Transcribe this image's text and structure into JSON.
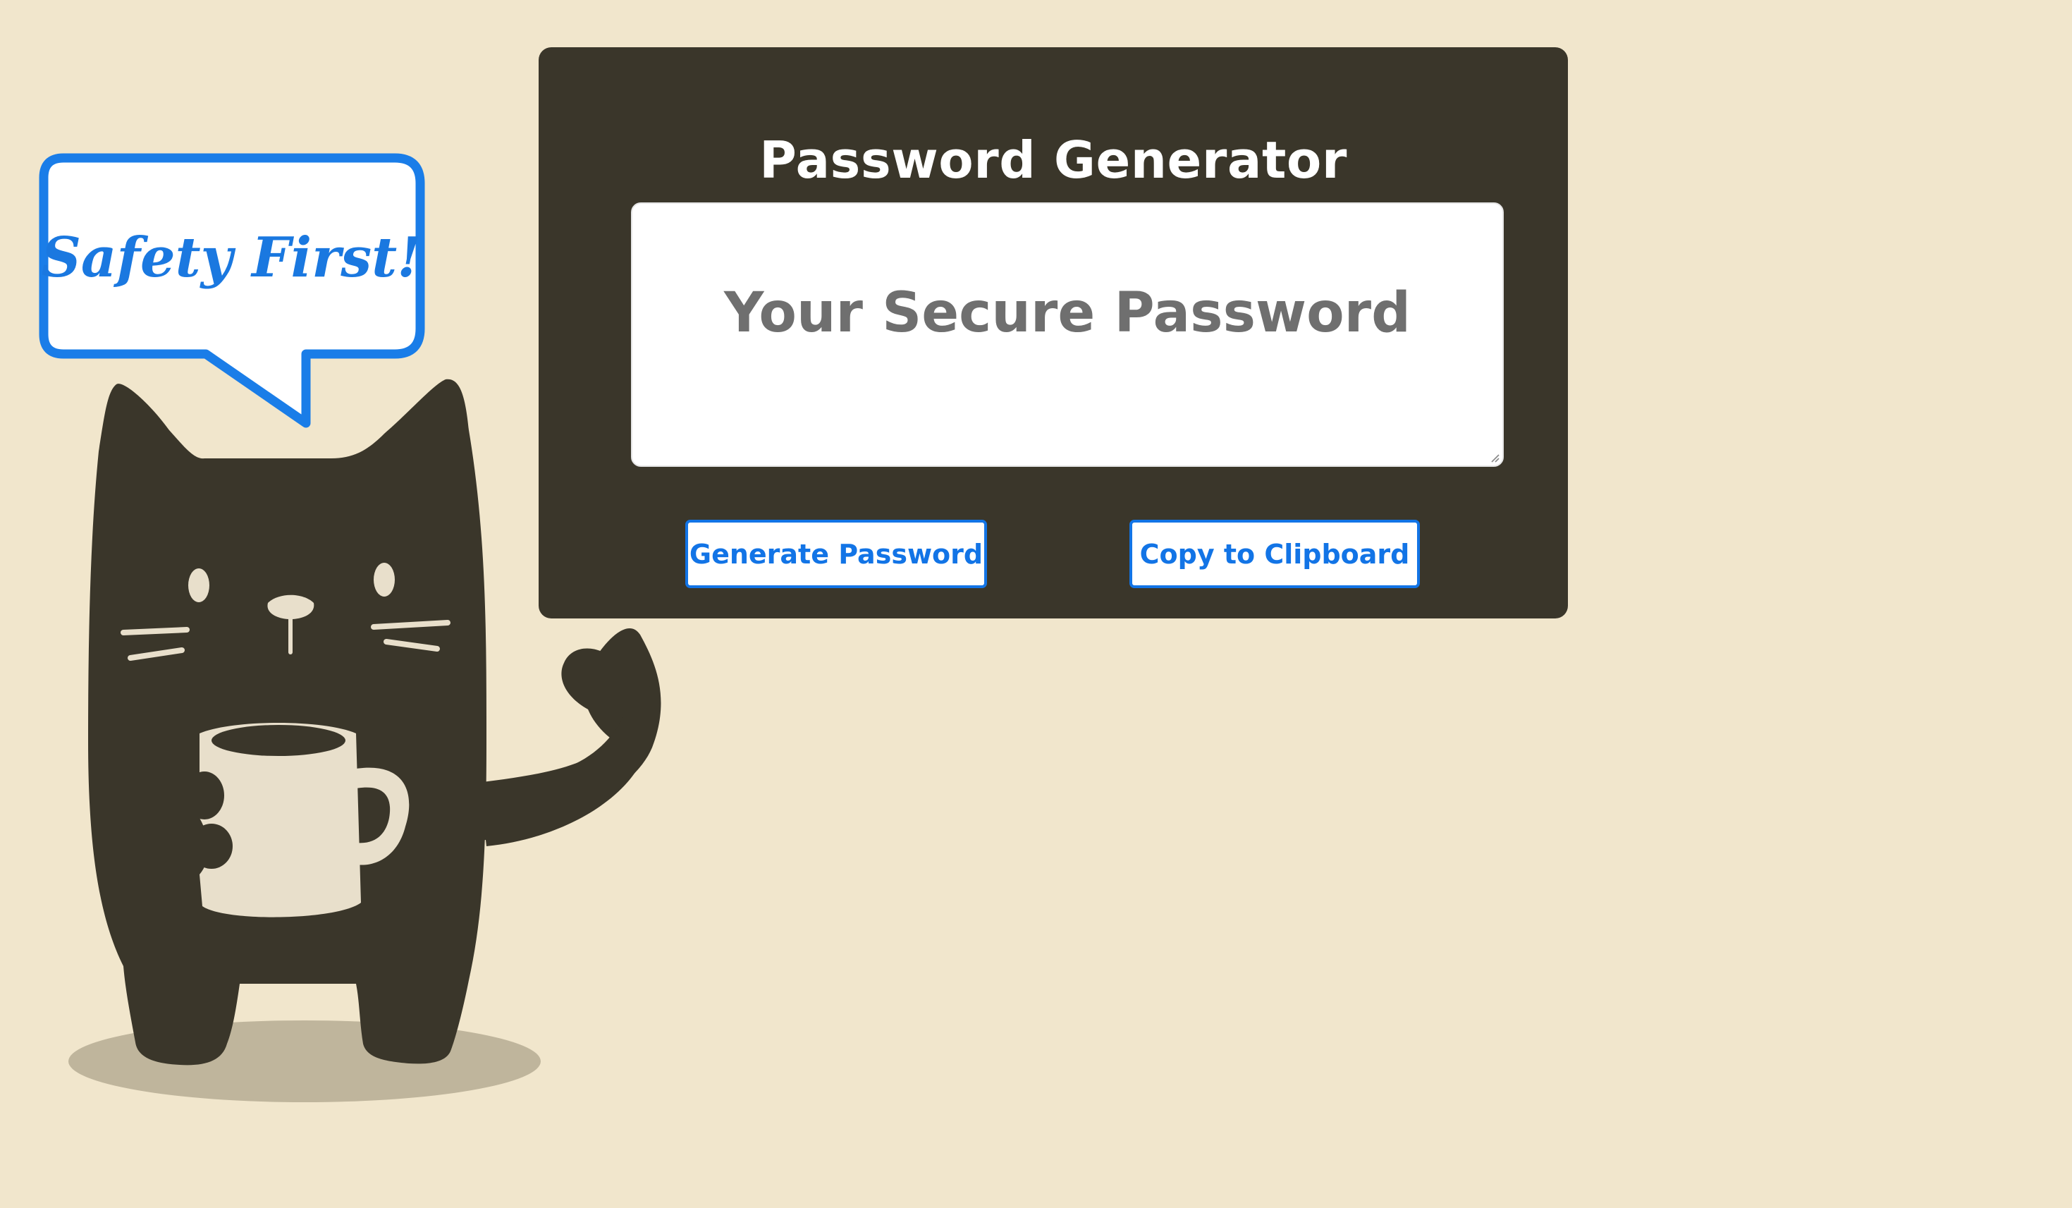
{
  "illustration": {
    "speech_bubble_text": "Safety First!",
    "colors": {
      "bubble_border": "#1a7de8",
      "bubble_text": "#1a78e0",
      "cat_body": "#3a362a",
      "mug": "#e8dfcb",
      "shadow": "#bfb59c"
    }
  },
  "card": {
    "title": "Password Generator",
    "password_placeholder": "Your Secure Password",
    "password_value": "",
    "generate_button_label": "Generate Password",
    "copy_button_label": "Copy to Clipboard"
  },
  "colors": {
    "page_background": "#f1e6cc",
    "card_background": "#3a362a",
    "accent": "#1274e6",
    "placeholder_text": "#6f6f6f"
  }
}
